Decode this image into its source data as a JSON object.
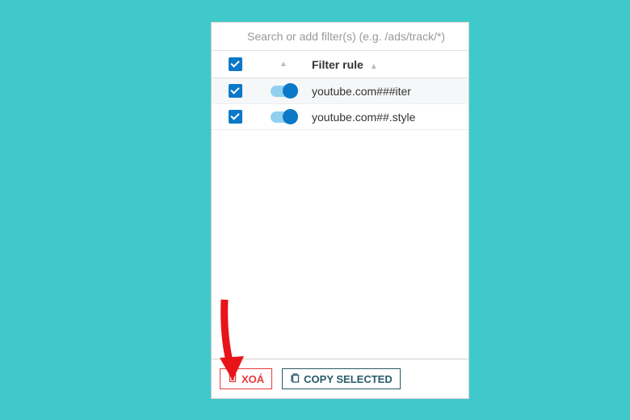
{
  "search": {
    "placeholder": "Search or add filter(s) (e.g. /ads/track/*)"
  },
  "table": {
    "header": {
      "rule_label": "Filter rule"
    },
    "rows": [
      {
        "rule": "youtube.com###iter"
      },
      {
        "rule": "youtube.com##.style"
      }
    ]
  },
  "footer": {
    "delete_label": "XOÁ",
    "copy_label": "COPY SELECTED"
  },
  "colors": {
    "accent": "#0b78c8",
    "danger": "#e83a3a",
    "teal_bg": "#3fc9ca"
  }
}
